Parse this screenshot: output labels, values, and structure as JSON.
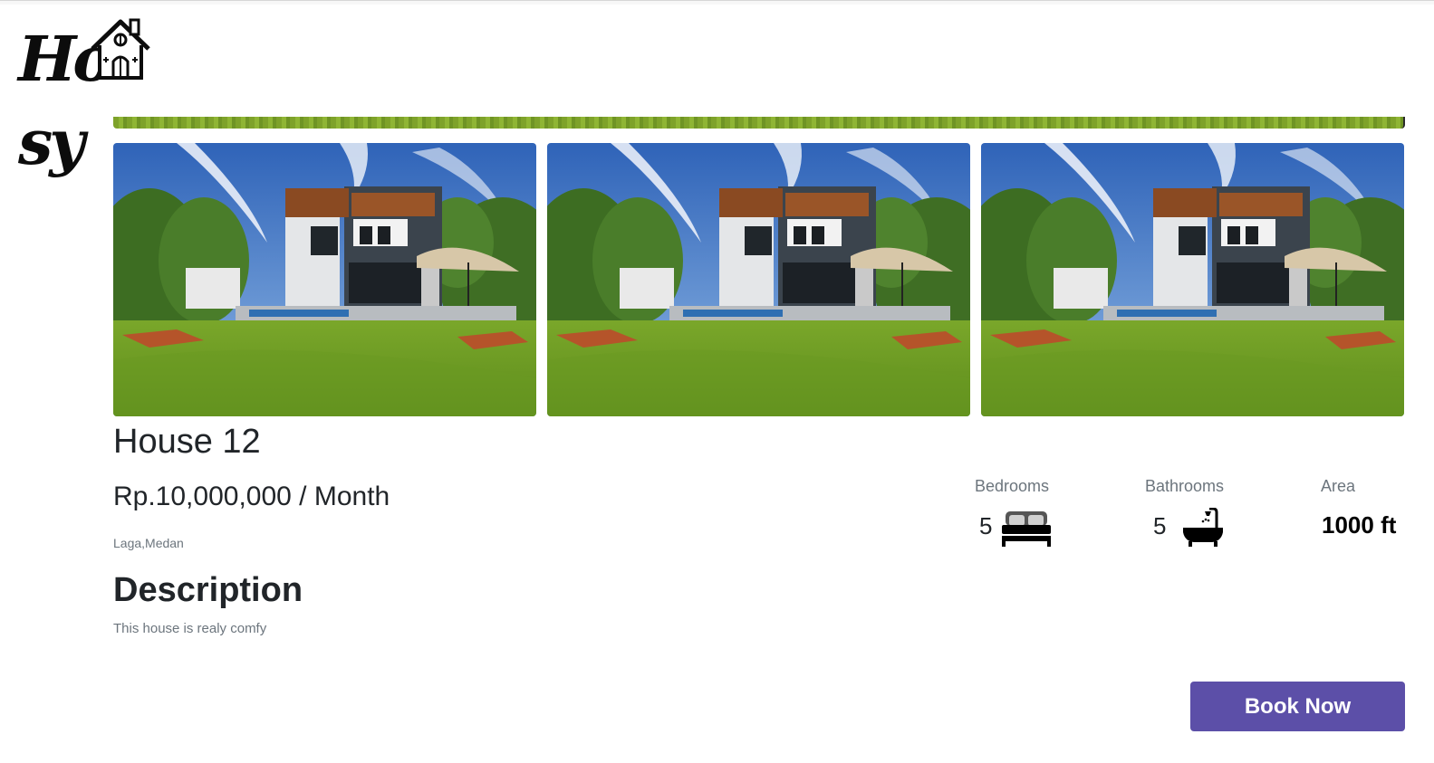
{
  "brand": {
    "logo_text": "Housy"
  },
  "listing": {
    "title": "House 12",
    "price": "Rp.10,000,000 / Month",
    "location": "Laga,Medan",
    "description_heading": "Description",
    "description": "This house is realy comfy",
    "photos_count": 3
  },
  "stats": {
    "bedrooms": {
      "label": "Bedrooms",
      "value": "5",
      "icon": "bed-icon"
    },
    "bathrooms": {
      "label": "Bathrooms",
      "value": "5",
      "icon": "bathtub-icon"
    },
    "area": {
      "label": "Area",
      "value": "1000 ft"
    }
  },
  "actions": {
    "book_label": "Book Now"
  },
  "colors": {
    "accent": "#5c4fa8",
    "text": "#212529",
    "muted": "#6c757d"
  }
}
